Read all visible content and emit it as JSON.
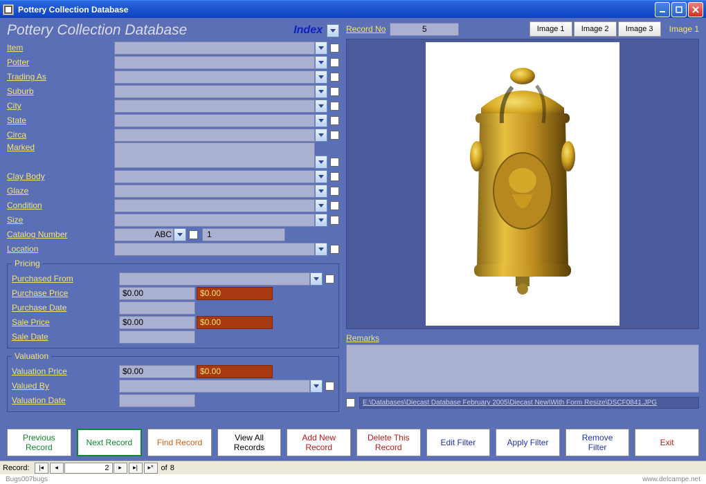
{
  "window": {
    "title": "Pottery Collection Database"
  },
  "header": {
    "title": "Pottery Collection Database",
    "index_label": "Index"
  },
  "fields": {
    "item": "Item",
    "potter": "Potter",
    "trading_as": "Trading As",
    "suburb": "Suburb",
    "city": "City",
    "state": "State",
    "circa": "Circa",
    "marked": "Marked",
    "clay_body": "Clay Body",
    "glaze": "Glaze",
    "condition": "Condition",
    "size": "Size",
    "catalog_number": "Catalog Number",
    "catalog_abc": "ABC",
    "catalog_num": "1",
    "location": "Location"
  },
  "pricing": {
    "legend": "Pricing",
    "purchased_from": "Purchased From",
    "purchase_price": "Purchase Price",
    "purchase_price_val": "$0.00",
    "purchase_price_conv": "$0.00",
    "purchase_date": "Purchase Date",
    "sale_price": "Sale Price",
    "sale_price_val": "$0.00",
    "sale_price_conv": "$0.00",
    "sale_date": "Sale Date"
  },
  "valuation": {
    "legend": "Valuation",
    "valuation_price": "Valuation Price",
    "valuation_price_val": "$0.00",
    "valuation_price_conv": "$0.00",
    "valued_by": "Valued By",
    "valuation_date": "Valuation Date"
  },
  "right": {
    "record_no_label": "Record No",
    "record_no": "5",
    "image_buttons": [
      "Image 1",
      "Image 2",
      "Image 3"
    ],
    "current_image": "Image 1",
    "remarks_label": "Remarks",
    "path": "E:\\Databases\\Diecast Database February 2005\\Diecast New\\With Form Resize\\DSCF0841.JPG"
  },
  "buttons": {
    "previous": "Previous\nRecord",
    "next": "Next Record",
    "find": "Find Record",
    "view_all": "View All\nRecords",
    "add_new": "Add New\nRecord",
    "delete": "Delete This\nRecord",
    "edit_filter": "Edit Filter",
    "apply_filter": "Apply Filter",
    "remove_filter": "Remove\nFilter",
    "exit": "Exit"
  },
  "nav": {
    "label": "Record:",
    "current": "2",
    "of": "of",
    "total": "8"
  },
  "footer": {
    "left": "Bugs007bugs",
    "right": "www.delcampe.net"
  }
}
